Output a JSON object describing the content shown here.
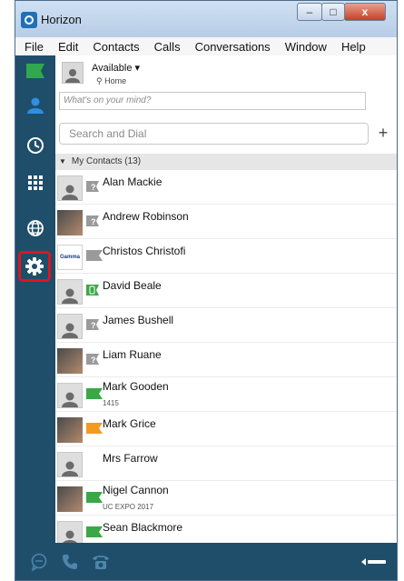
{
  "window": {
    "title": "Horizon",
    "controls": {
      "minimize": "–",
      "maximize": "□",
      "close": "x"
    }
  },
  "menu": [
    "File",
    "Edit",
    "Contacts",
    "Calls",
    "Conversations",
    "Window",
    "Help"
  ],
  "sidebar": {
    "items": [
      {
        "name": "presence-flag",
        "icon": "green-flag-icon",
        "color": "#2fa84f"
      },
      {
        "name": "contacts",
        "icon": "person-icon",
        "color": "#2f8fe0"
      },
      {
        "name": "history",
        "icon": "clock-icon"
      },
      {
        "name": "dialpad",
        "icon": "dialpad-icon"
      },
      {
        "name": "web",
        "icon": "globe-icon"
      },
      {
        "name": "settings",
        "icon": "gear-icon",
        "highlighted": true,
        "highlight_color": "#e0141e"
      }
    ]
  },
  "presence": {
    "status": "Available ▾",
    "location": "⚲ Home",
    "mind_placeholder": "What's on your mind?"
  },
  "search": {
    "placeholder": "Search and Dial",
    "add_label": "+"
  },
  "group": {
    "toggle": "▼",
    "label": "My Contacts (13)"
  },
  "contacts": [
    {
      "name": "Alan Mackie",
      "sub": "",
      "avatar": "default",
      "status": "unknown"
    },
    {
      "name": "Andrew Robinson",
      "sub": "",
      "avatar": "photo",
      "status": "unknown"
    },
    {
      "name": "Christos Christofi",
      "sub": "",
      "avatar": "logo",
      "logo_text": "Gamma",
      "status": "offline"
    },
    {
      "name": "David Beale",
      "sub": "",
      "avatar": "default",
      "status": "mobile"
    },
    {
      "name": "James Bushell",
      "sub": "",
      "avatar": "default",
      "status": "unknown"
    },
    {
      "name": "Liam Ruane",
      "sub": "",
      "avatar": "photo",
      "status": "unknown"
    },
    {
      "name": "Mark Gooden",
      "sub": "1415",
      "avatar": "default",
      "status": "available"
    },
    {
      "name": "Mark Grice",
      "sub": "",
      "avatar": "photo",
      "status": "away"
    },
    {
      "name": "Mrs Farrow",
      "sub": "",
      "avatar": "default",
      "status": "none"
    },
    {
      "name": "Nigel Cannon",
      "sub": "UC EXPO 2017",
      "avatar": "photo",
      "status": "available"
    },
    {
      "name": "Sean Blackmore",
      "sub": "",
      "avatar": "default",
      "status": "available"
    }
  ],
  "status_colors": {
    "available": "#39a845",
    "away": "#f39a1f",
    "offline": "#9a9a9a",
    "unknown": "#9a9a9a",
    "mobile": "#39a845"
  },
  "bottom_bar": {
    "items": [
      {
        "icon": "chat-bubble-icon"
      },
      {
        "icon": "phone-icon"
      },
      {
        "icon": "desk-phone-icon"
      },
      {
        "icon": "collapse-arrow-icon"
      }
    ]
  }
}
